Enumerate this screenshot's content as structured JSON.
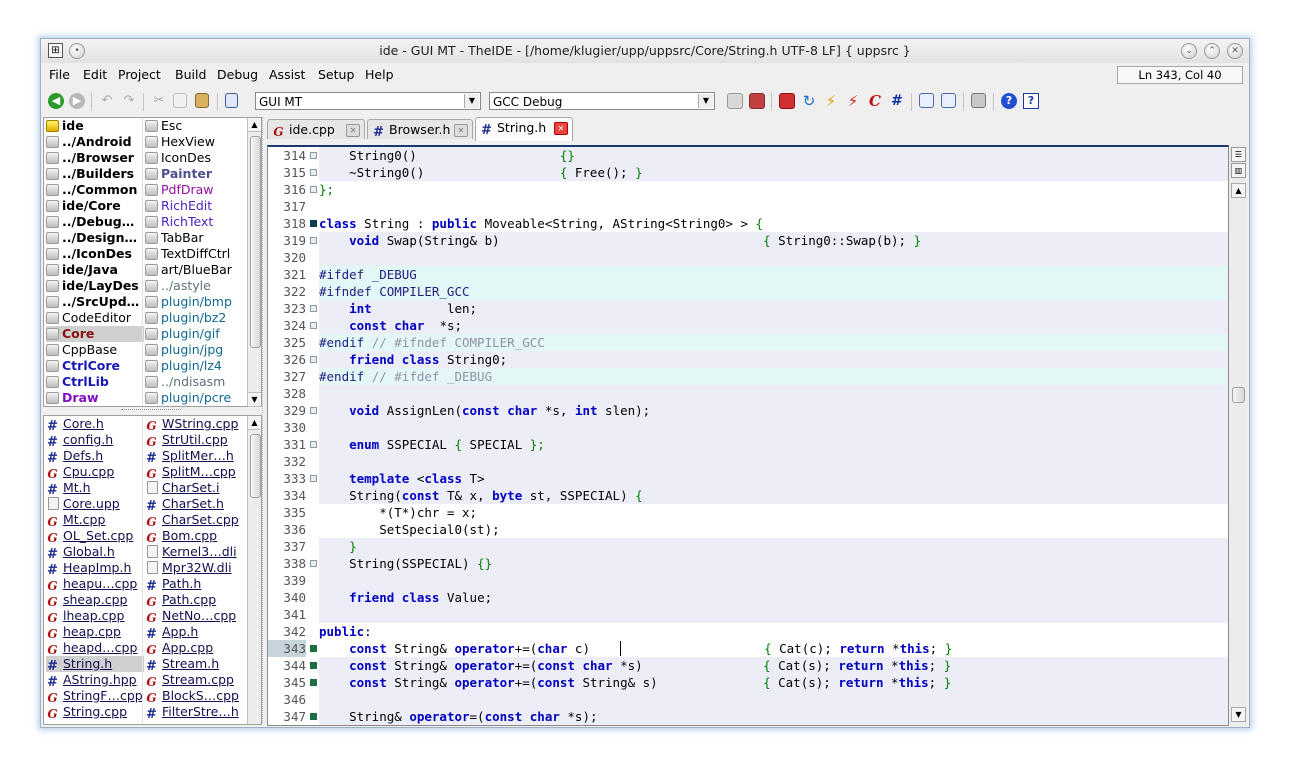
{
  "window": {
    "title": "ide - GUI MT - TheIDE - [/home/klugier/upp/uppsrc/Core/String.h UTF-8 LF] { uppsrc }"
  },
  "menu": [
    "File",
    "Edit",
    "Project",
    "Build",
    "Debug",
    "Assist",
    "Setup",
    "Help"
  ],
  "status": {
    "position": "Ln 343, Col 40"
  },
  "toolbar": {
    "method_combo": "GUI MT",
    "build_combo": "GCC Debug"
  },
  "packages": {
    "col1": [
      {
        "label": "ide",
        "style": "bold",
        "icon": "main-package-icon"
      },
      {
        "label": "../Android",
        "style": "bold",
        "icon": "package-icon"
      },
      {
        "label": "../Browser",
        "style": "bold",
        "icon": "package-icon"
      },
      {
        "label": "../Builders",
        "style": "bold",
        "icon": "package-icon"
      },
      {
        "label": "../Common",
        "style": "bold",
        "icon": "package-icon"
      },
      {
        "label": "ide/Core",
        "style": "bold",
        "icon": "package-icon"
      },
      {
        "label": "../Debug…",
        "style": "bold",
        "icon": "package-icon"
      },
      {
        "label": "../Design…",
        "style": "bold",
        "icon": "package-icon"
      },
      {
        "label": "../IconDes",
        "style": "bold",
        "icon": "package-icon"
      },
      {
        "label": "ide/Java",
        "style": "bold",
        "icon": "package-icon"
      },
      {
        "label": "ide/LayDes",
        "style": "bold",
        "icon": "package-icon"
      },
      {
        "label": "../SrcUpd…",
        "style": "bold",
        "icon": "package-icon"
      },
      {
        "label": "CodeEditor",
        "style": "normal",
        "icon": "package-icon"
      },
      {
        "label": "Core",
        "style": "core",
        "icon": "package-icon"
      },
      {
        "label": "CppBase",
        "style": "normal",
        "icon": "package-icon"
      },
      {
        "label": "CtrlCore",
        "style": "blue",
        "icon": "package-icon"
      },
      {
        "label": "CtrlLib",
        "style": "blue",
        "icon": "package-icon"
      },
      {
        "label": "Draw",
        "style": "purple",
        "icon": "package-icon"
      }
    ],
    "col2": [
      {
        "label": "Esc",
        "style": "normal",
        "icon": "package-icon"
      },
      {
        "label": "HexView",
        "style": "normal",
        "icon": "package-icon"
      },
      {
        "label": "IconDes",
        "style": "normal",
        "icon": "package-icon"
      },
      {
        "label": "Painter",
        "style": "painter",
        "icon": "package-icon"
      },
      {
        "label": "PdfDraw",
        "style": "magenta",
        "icon": "package-icon"
      },
      {
        "label": "RichEdit",
        "style": "purple2",
        "icon": "package-icon"
      },
      {
        "label": "RichText",
        "style": "purple2",
        "icon": "package-icon"
      },
      {
        "label": "TabBar",
        "style": "normal",
        "icon": "package-icon"
      },
      {
        "label": "TextDiffCtrl",
        "style": "normal",
        "icon": "package-icon"
      },
      {
        "label": "art/BlueBar",
        "style": "normal",
        "icon": "package-icon"
      },
      {
        "label": "../astyle",
        "style": "gray",
        "icon": "package-icon"
      },
      {
        "label": "plugin/bmp",
        "style": "teal",
        "icon": "package-icon"
      },
      {
        "label": "plugin/bz2",
        "style": "teal",
        "icon": "package-icon"
      },
      {
        "label": "plugin/gif",
        "style": "teal",
        "icon": "package-icon"
      },
      {
        "label": "plugin/jpg",
        "style": "teal",
        "icon": "package-icon"
      },
      {
        "label": "plugin/lz4",
        "style": "teal",
        "icon": "package-icon"
      },
      {
        "label": "../ndisasm",
        "style": "gray",
        "icon": "package-icon"
      },
      {
        "label": "plugin/pcre",
        "style": "teal",
        "icon": "package-icon"
      }
    ]
  },
  "files": {
    "col1": [
      {
        "label": "Core.h",
        "icon": "header-icon"
      },
      {
        "label": "config.h",
        "icon": "header-icon"
      },
      {
        "label": "Defs.h",
        "icon": "header-icon"
      },
      {
        "label": "Cpu.cpp",
        "icon": "cpp-icon"
      },
      {
        "label": "Mt.h",
        "icon": "header-icon"
      },
      {
        "label": "Core.upp",
        "icon": "doc-icon"
      },
      {
        "label": "Mt.cpp",
        "icon": "cpp-icon"
      },
      {
        "label": "OL_Set.cpp",
        "icon": "cpp-icon"
      },
      {
        "label": "Global.h",
        "icon": "header-icon"
      },
      {
        "label": "HeapImp.h",
        "icon": "header-icon"
      },
      {
        "label": "heapu…cpp",
        "icon": "cpp-icon"
      },
      {
        "label": "sheap.cpp",
        "icon": "cpp-icon"
      },
      {
        "label": "lheap.cpp",
        "icon": "cpp-icon"
      },
      {
        "label": "heap.cpp",
        "icon": "cpp-icon"
      },
      {
        "label": "heapd…cpp",
        "icon": "cpp-icon"
      },
      {
        "label": "String.h",
        "icon": "header-icon",
        "selected": true
      },
      {
        "label": "AString.hpp",
        "icon": "header-icon"
      },
      {
        "label": "StringF…cpp",
        "icon": "cpp-icon"
      },
      {
        "label": "String.cpp",
        "icon": "cpp-icon"
      }
    ],
    "col2": [
      {
        "label": "WString.cpp",
        "icon": "cpp-icon"
      },
      {
        "label": "StrUtil.cpp",
        "icon": "cpp-icon"
      },
      {
        "label": "SplitMer…h",
        "icon": "header-icon"
      },
      {
        "label": "SplitM…cpp",
        "icon": "cpp-icon"
      },
      {
        "label": "CharSet.i",
        "icon": "doc-icon"
      },
      {
        "label": "CharSet.h",
        "icon": "header-icon"
      },
      {
        "label": "CharSet.cpp",
        "icon": "cpp-icon"
      },
      {
        "label": "Bom.cpp",
        "icon": "cpp-icon"
      },
      {
        "label": "Kernel3…dli",
        "icon": "doc-icon"
      },
      {
        "label": "Mpr32W.dli",
        "icon": "doc-icon"
      },
      {
        "label": "Path.h",
        "icon": "header-icon"
      },
      {
        "label": "Path.cpp",
        "icon": "cpp-icon"
      },
      {
        "label": "NetNo…cpp",
        "icon": "cpp-icon"
      },
      {
        "label": "App.h",
        "icon": "header-icon"
      },
      {
        "label": "App.cpp",
        "icon": "cpp-icon"
      },
      {
        "label": "Stream.h",
        "icon": "header-icon"
      },
      {
        "label": "Stream.cpp",
        "icon": "cpp-icon"
      },
      {
        "label": "BlockS…cpp",
        "icon": "cpp-icon"
      },
      {
        "label": "FilterStre…h",
        "icon": "header-icon"
      }
    ]
  },
  "tabs": [
    {
      "label": "ide.cpp",
      "icon": "cpp-icon",
      "active": false
    },
    {
      "label": "Browser.h",
      "icon": "header-icon",
      "active": false
    },
    {
      "label": "String.h",
      "icon": "header-icon",
      "active": true
    }
  ],
  "editor": {
    "current_line": 343,
    "lines": [
      {
        "n": "314",
        "mark": "n",
        "bg": "#ededf7",
        "html": "    String0()                   {}"
      },
      {
        "n": "315",
        "mark": "n",
        "bg": "#ededf7",
        "html": "    ~String0()                  { Free(); }"
      },
      {
        "n": "316",
        "mark": "n",
        "bg": "#ffffff",
        "html": "};"
      },
      {
        "n": "317",
        "mark": "",
        "bg": "#ffffff",
        "html": ""
      },
      {
        "n": "318",
        "mark": "b",
        "bg": "#ffffff",
        "html": "class String : public Moveable<String, AString<String0> > {"
      },
      {
        "n": "319",
        "mark": "n",
        "bg": "#ededf7",
        "html": "    void Swap(String& b)                                   { String0::Swap(b); }"
      },
      {
        "n": "320",
        "mark": "",
        "bg": "#ededf7",
        "html": ""
      },
      {
        "n": "321",
        "mark": "",
        "bg": "#e3f7f7",
        "html": "#ifdef _DEBUG"
      },
      {
        "n": "322",
        "mark": "",
        "bg": "#e3f7f7",
        "html": "#ifndef COMPILER_GCC"
      },
      {
        "n": "323",
        "mark": "n",
        "bg": "#ededf7",
        "html": "    int          len;"
      },
      {
        "n": "324",
        "mark": "n",
        "bg": "#ededf7",
        "html": "    const char  *s;"
      },
      {
        "n": "325",
        "mark": "",
        "bg": "#e3f7f7",
        "html": "#endif // #ifndef COMPILER_GCC"
      },
      {
        "n": "326",
        "mark": "n",
        "bg": "#ededf7",
        "html": "    friend class String0;"
      },
      {
        "n": "327",
        "mark": "",
        "bg": "#e3f7f7",
        "html": "#endif // #ifdef _DEBUG"
      },
      {
        "n": "328",
        "mark": "",
        "bg": "#ededf7",
        "html": ""
      },
      {
        "n": "329",
        "mark": "n",
        "bg": "#ededf7",
        "html": "    void AssignLen(const char *s, int slen);"
      },
      {
        "n": "330",
        "mark": "",
        "bg": "#ededf7",
        "html": ""
      },
      {
        "n": "331",
        "mark": "n",
        "bg": "#ededf7",
        "html": "    enum SSPECIAL { SPECIAL };"
      },
      {
        "n": "332",
        "mark": "",
        "bg": "#ededf7",
        "html": ""
      },
      {
        "n": "333",
        "mark": "n",
        "bg": "#ededf7",
        "html": "    template <class T>"
      },
      {
        "n": "334",
        "mark": "",
        "bg": "#ededf7",
        "html": "    String(const T& x, byte st, SSPECIAL) {"
      },
      {
        "n": "335",
        "mark": "",
        "bg": "#ffffff",
        "html": "        *(T*)chr = x;"
      },
      {
        "n": "336",
        "mark": "",
        "bg": "#ffffff",
        "html": "        SetSpecial0(st);"
      },
      {
        "n": "337",
        "mark": "",
        "bg": "#ededf7",
        "html": "    }"
      },
      {
        "n": "338",
        "mark": "n",
        "bg": "#ededf7",
        "html": "    String(SSPECIAL) {}"
      },
      {
        "n": "339",
        "mark": "",
        "bg": "#ededf7",
        "html": ""
      },
      {
        "n": "340",
        "mark": "",
        "bg": "#ededf7",
        "html": "    friend class Value;"
      },
      {
        "n": "341",
        "mark": "",
        "bg": "#ededf7",
        "html": ""
      },
      {
        "n": "342",
        "mark": "",
        "bg": "#ffffff",
        "html": "public:"
      },
      {
        "n": "343",
        "mark": "g",
        "bg": "#ffffff",
        "html": "    const String& operator+=(char c)    |                   { Cat(c); return *this; }"
      },
      {
        "n": "344",
        "mark": "g",
        "bg": "#ededf7",
        "html": "    const String& operator+=(const char *s)                { Cat(s); return *this; }"
      },
      {
        "n": "345",
        "mark": "g",
        "bg": "#ededf7",
        "html": "    const String& operator+=(const String& s)              { Cat(s); return *this; }"
      },
      {
        "n": "346",
        "mark": "",
        "bg": "#ededf7",
        "html": ""
      },
      {
        "n": "347",
        "mark": "g",
        "bg": "#ededf7",
        "html": "    String& operator=(const char *s);"
      }
    ]
  }
}
